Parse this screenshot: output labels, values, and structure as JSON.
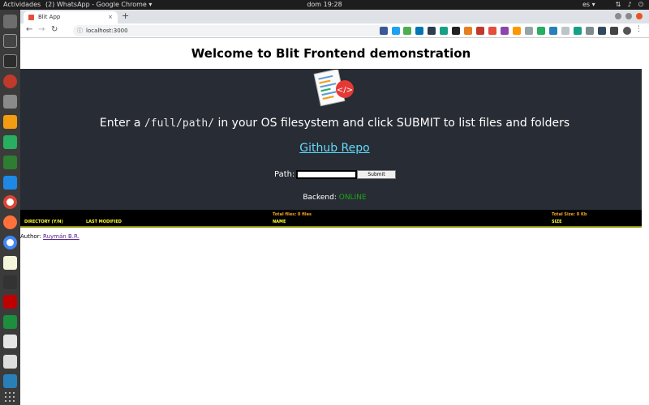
{
  "system": {
    "activities": "Actividades",
    "app_menu": "(2) WhatsApp - Google Chrome ▾",
    "clock": "dom 19:28",
    "lang": "es ▾"
  },
  "browser": {
    "tab_title": "Blit App",
    "tab_close": "×",
    "new_tab": "+",
    "url": "localhost:3000",
    "back": "←",
    "forward": "→",
    "reload": "↻",
    "info_icon": "ⓘ",
    "star": "☆"
  },
  "page": {
    "title": "Welcome to Blit Frontend demonstration",
    "instruction_prefix": "Enter a ",
    "instruction_code": "/full/path/",
    "instruction_suffix": " in your OS filesystem and click SUBMIT to list files and folders",
    "repo_link": "Github Repo",
    "path_label": "Path:",
    "path_value": "",
    "submit_label": "Submit",
    "backend_label": "Backend:",
    "backend_status": "ONLINE",
    "author_label": "Author:",
    "author_name": "Ruymán B.R."
  },
  "table": {
    "total_files": "Total files: 0 files",
    "total_size": "Total Size: 0 Kb",
    "columns": [
      "DIRECTORY (Y/N)",
      "LAST MODIFIED",
      "NAME",
      "SIZE"
    ],
    "rows": []
  },
  "colors": {
    "hero_bg": "#282c34",
    "link": "#61dafb",
    "online": "#19a819",
    "header_text": "#ffff33"
  }
}
